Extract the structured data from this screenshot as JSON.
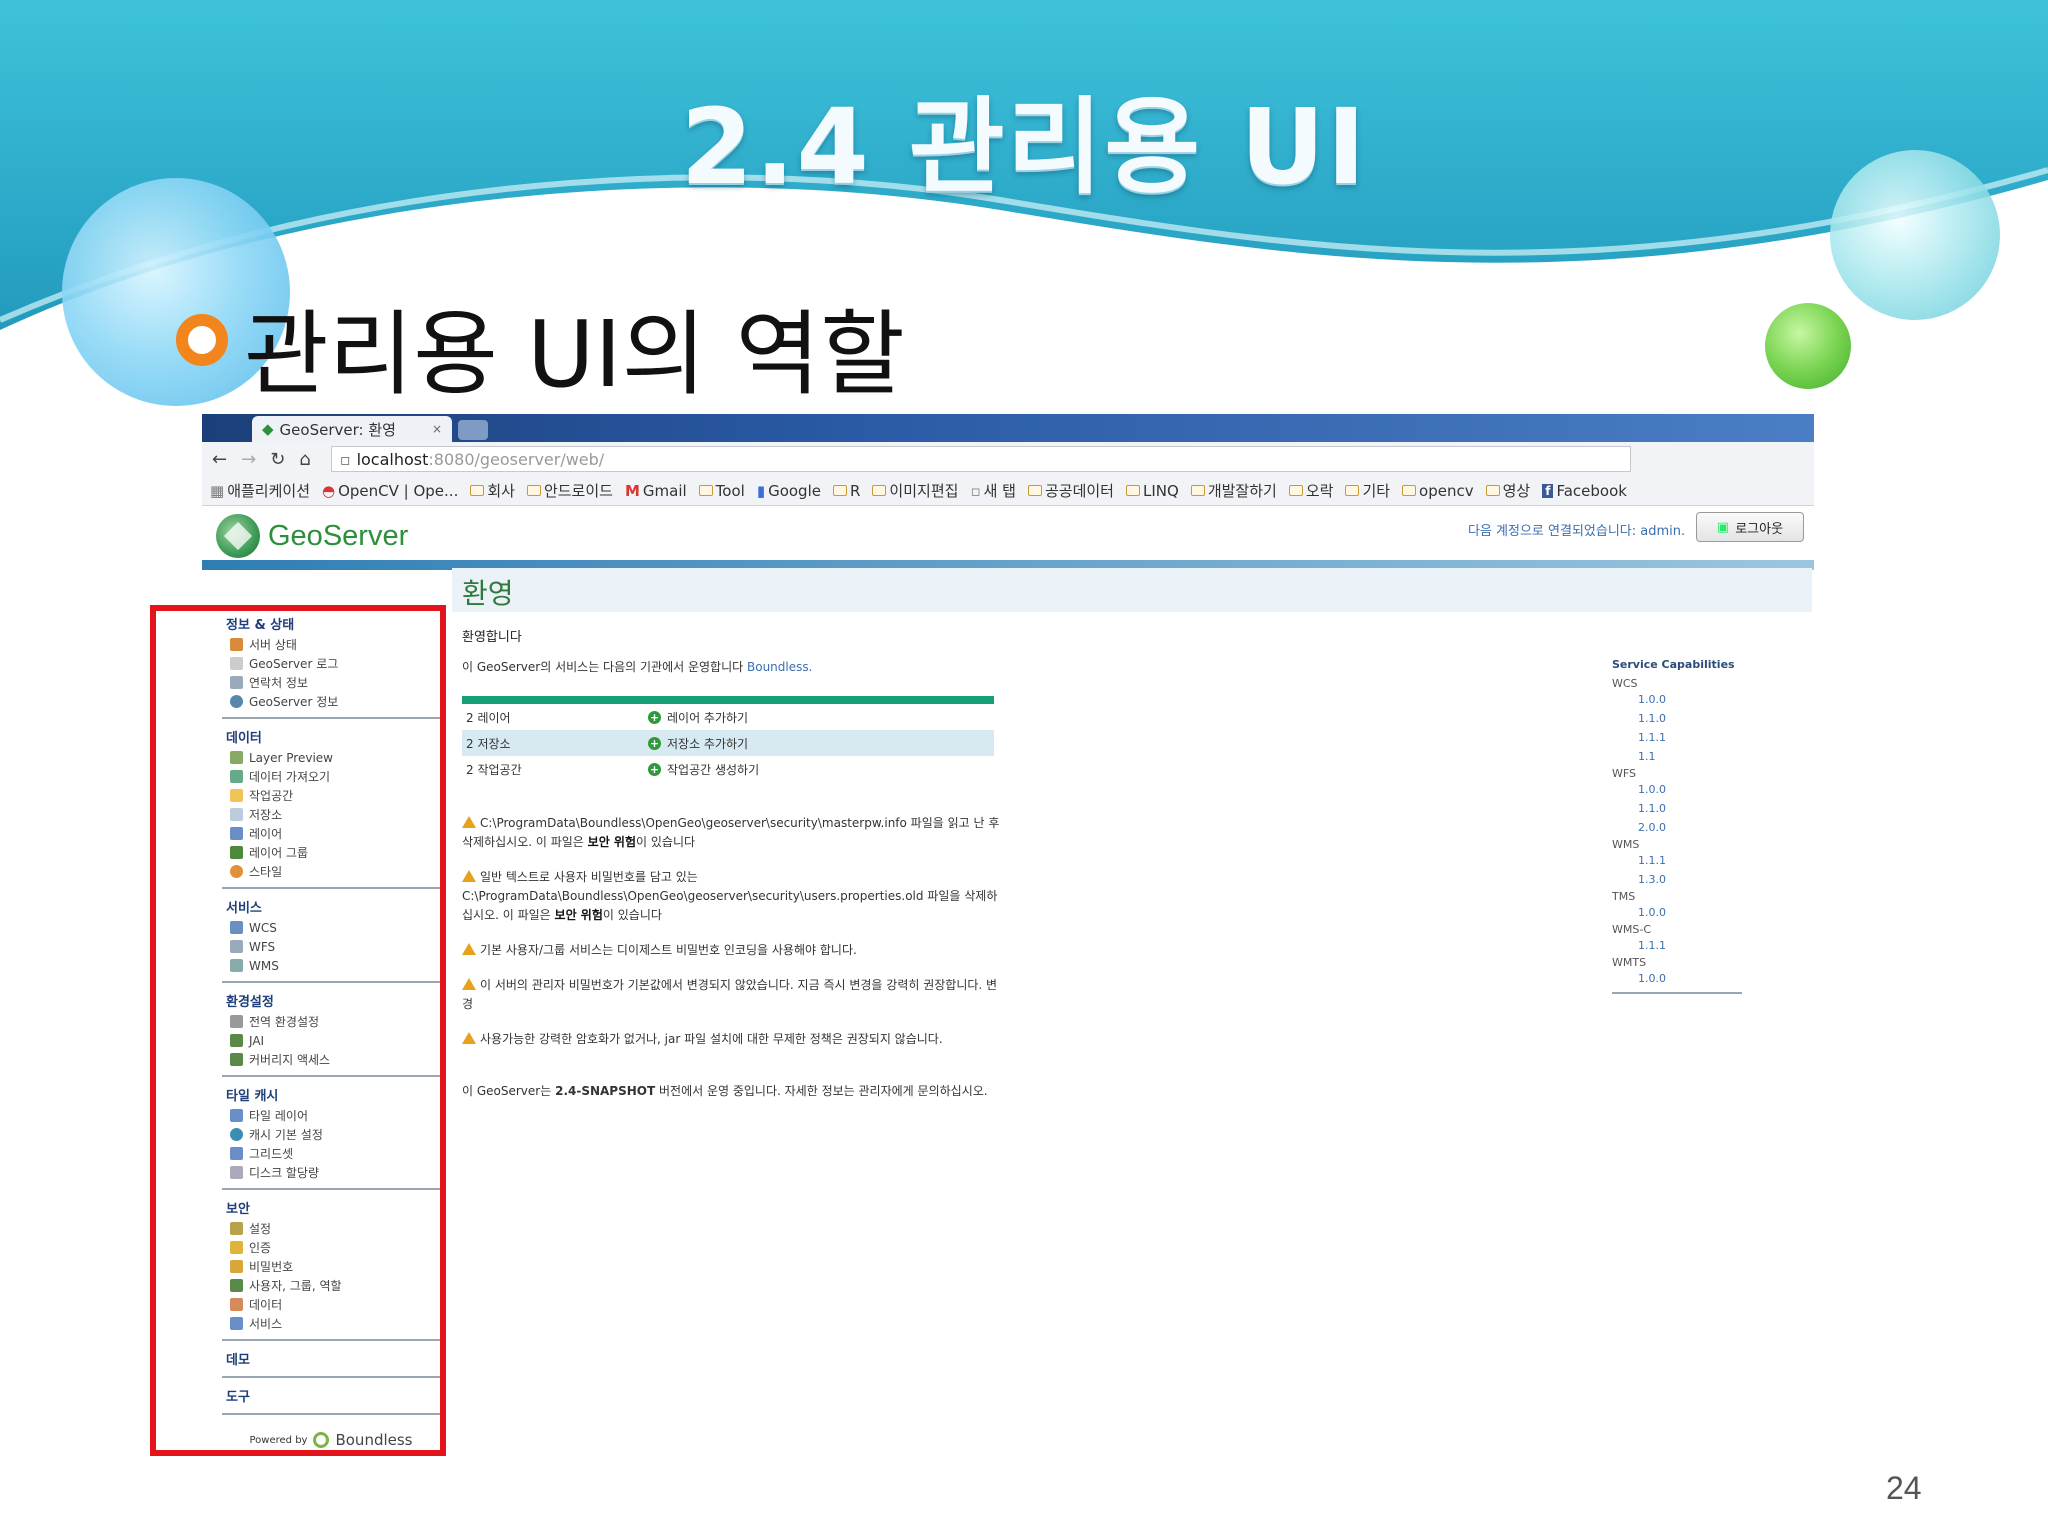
{
  "slide": {
    "title": "2.4 관리용 UI",
    "subtitle": "관리용 UI의 역할",
    "page_number": "24"
  },
  "browser": {
    "tab_title": "GeoServer: 환영",
    "tab_close": "×",
    "url_host": "localhost",
    "url_path": ":8080/geoserver/web/",
    "bookmarks": [
      "애플리케이션",
      "OpenCV | Ope...",
      "회사",
      "안드로이드",
      "Gmail",
      "Tool",
      "Google",
      "R",
      "이미지편집",
      "새 탭",
      "공공데이터",
      "LINQ",
      "개발잘하기",
      "오락",
      "기타",
      "opencv",
      "영상",
      "Facebook"
    ]
  },
  "geoserver": {
    "logo_text": "GeoServer",
    "login_text": "다음 계정으로 연결되었습니다: admin.",
    "logout_label": "로그아웃",
    "sidebar": [
      {
        "heading": "정보 & 상태",
        "items": [
          "서버 상태",
          "GeoServer 로그",
          "연락처 정보",
          "GeoServer 정보"
        ]
      },
      {
        "heading": "데이터",
        "items": [
          "Layer Preview",
          "데이터 가져오기",
          "작업공간",
          "저장소",
          "레이어",
          "레이어 그룹",
          "스타일"
        ]
      },
      {
        "heading": "서비스",
        "items": [
          "WCS",
          "WFS",
          "WMS"
        ]
      },
      {
        "heading": "환경설정",
        "items": [
          "전역 환경설정",
          "JAI",
          "커버리지 액세스"
        ]
      },
      {
        "heading": "타일 캐시",
        "items": [
          "타일 레이어",
          "캐시 기본 설정",
          "그리드셋",
          "디스크 할당량"
        ]
      },
      {
        "heading": "보안",
        "items": [
          "설정",
          "인증",
          "비밀번호",
          "사용자, 그룹, 역할",
          "데이터",
          "서비스"
        ]
      },
      {
        "heading": "데모",
        "items": []
      },
      {
        "heading": "도구",
        "items": []
      }
    ],
    "powered_by": "Powered by",
    "powered_brand": "Boundless",
    "main": {
      "title": "환영",
      "welcome": "환영합니다",
      "intro": "이 GeoServer의 서비스는 다음의 기관에서 운영합니다",
      "intro_link": "Boundless.",
      "summary": [
        {
          "count": "2 레이어",
          "action": "레이어 추가하기"
        },
        {
          "count": "2 저장소",
          "action": "저장소 추가하기"
        },
        {
          "count": "2 작업공간",
          "action": "작업공간 생성하기"
        }
      ],
      "warnings": [
        {
          "text": "C:\\ProgramData\\Boundless\\OpenGeo\\geoserver\\security\\masterpw.info 파일을 읽고 난 후 삭제하십시오. 이 파일은 ",
          "bold": "보안 위험",
          "tail": "이 있습니다"
        },
        {
          "text": "일반 텍스트로 사용자 비밀번호를 담고 있는 C:\\ProgramData\\Boundless\\OpenGeo\\geoserver\\security\\users.properties.old 파일을 삭제하십시오. 이 파일은 ",
          "bold": "보안 위험",
          "tail": "이 있습니다"
        },
        {
          "text": "기본 사용자/그룹 서비스는 디이제스트 비밀번호 인코딩을 사용해야 합니다.",
          "bold": "",
          "tail": ""
        },
        {
          "text": "이 서버의 관리자 비밀번호가 기본값에서 변경되지 않았습니다. 지금 즉시 변경을 강력히 권장합니다. 변경",
          "bold": "",
          "tail": ""
        },
        {
          "text": "사용가능한 강력한 암호화가 없거나, jar 파일 설치에 대한 무제한 정책은 권장되지 않습니다.",
          "bold": "",
          "tail": ""
        }
      ],
      "version_note_pre": "이 GeoServer는 ",
      "version_note_bold": "2.4-SNAPSHOT",
      "version_note_post": " 버전에서 운영 중입니다. 자세한 정보는 관리자에게 문의하십시오."
    },
    "capabilities": {
      "title": "Service Capabilities",
      "groups": [
        {
          "name": "WCS",
          "versions": [
            "1.0.0",
            "1.1.0",
            "1.1.1",
            "1.1"
          ]
        },
        {
          "name": "WFS",
          "versions": [
            "1.0.0",
            "1.1.0",
            "2.0.0"
          ]
        },
        {
          "name": "WMS",
          "versions": [
            "1.1.1",
            "1.3.0"
          ]
        },
        {
          "name": "TMS",
          "versions": [
            "1.0.0"
          ]
        },
        {
          "name": "WMS-C",
          "versions": [
            "1.1.1"
          ]
        },
        {
          "name": "WMTS",
          "versions": [
            "1.0.0"
          ]
        }
      ]
    }
  },
  "colors": {
    "highlight": "#e3141b",
    "bullet": "#f2861c",
    "geoserver_green": "#2c8f3a",
    "summary_bar": "#16a07a"
  }
}
